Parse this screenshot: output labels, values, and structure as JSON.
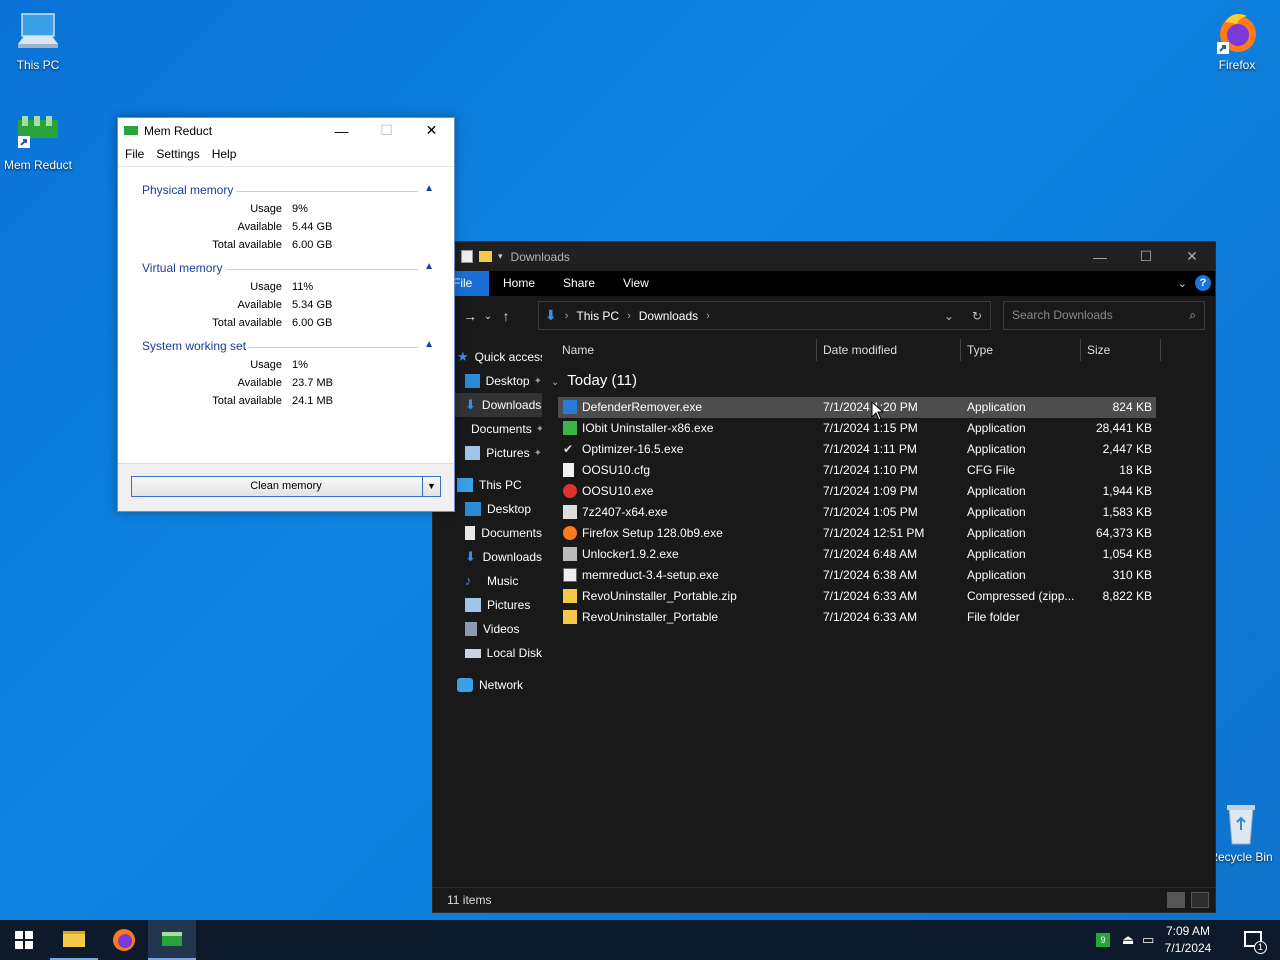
{
  "desktop": {
    "icons": {
      "this_pc": "This PC",
      "mem_reduct": "Mem Reduct",
      "firefox": "Firefox",
      "recycle_bin": "Recycle Bin"
    }
  },
  "memreduct": {
    "title": "Mem Reduct",
    "menu": [
      "File",
      "Settings",
      "Help"
    ],
    "groups": [
      {
        "title": "Physical memory",
        "rows": [
          {
            "label": "Usage",
            "value": "9%"
          },
          {
            "label": "Available",
            "value": "5.44 GB"
          },
          {
            "label": "Total available",
            "value": "6.00 GB"
          }
        ]
      },
      {
        "title": "Virtual memory",
        "rows": [
          {
            "label": "Usage",
            "value": "11%"
          },
          {
            "label": "Available",
            "value": "5.34 GB"
          },
          {
            "label": "Total available",
            "value": "6.00 GB"
          }
        ]
      },
      {
        "title": "System working set",
        "rows": [
          {
            "label": "Usage",
            "value": "1%"
          },
          {
            "label": "Available",
            "value": "23.7 MB"
          },
          {
            "label": "Total available",
            "value": "24.1 MB"
          }
        ]
      }
    ],
    "clean_button": "Clean memory"
  },
  "explorer": {
    "title": "Downloads",
    "ribbon_tabs": [
      "File",
      "Home",
      "Share",
      "View"
    ],
    "breadcrumb": [
      "This PC",
      "Downloads"
    ],
    "search_placeholder": "Search Downloads",
    "nav": {
      "quick_access": "Quick access",
      "pinned": [
        "Desktop",
        "Downloads",
        "Documents",
        "Pictures"
      ],
      "this_pc": "This PC",
      "this_pc_items": [
        "Desktop",
        "Documents",
        "Downloads",
        "Music",
        "Pictures",
        "Videos",
        "Local Disk"
      ],
      "network": "Network"
    },
    "columns": [
      "Name",
      "Date modified",
      "Type",
      "Size"
    ],
    "group_header": "Today (11)",
    "files": [
      {
        "name": "DefenderRemover.exe",
        "date": "7/1/2024 1:20 PM",
        "type": "Application",
        "size": "824 KB",
        "icon": "shield-app-icon"
      },
      {
        "name": "IObit Uninstaller-x86.exe",
        "date": "7/1/2024 1:15 PM",
        "type": "Application",
        "size": "28,441 KB",
        "icon": "iobit-icon"
      },
      {
        "name": "Optimizer-16.5.exe",
        "date": "7/1/2024 1:11 PM",
        "type": "Application",
        "size": "2,447 KB",
        "icon": "checkmark-icon"
      },
      {
        "name": "OOSU10.cfg",
        "date": "7/1/2024 1:10 PM",
        "type": "CFG File",
        "size": "18 KB",
        "icon": "blank-file-icon"
      },
      {
        "name": "OOSU10.exe",
        "date": "7/1/2024 1:09 PM",
        "type": "Application",
        "size": "1,944 KB",
        "icon": "oosu-icon"
      },
      {
        "name": "7z2407-x64.exe",
        "date": "7/1/2024 1:05 PM",
        "type": "Application",
        "size": "1,583 KB",
        "icon": "7zip-icon"
      },
      {
        "name": "Firefox Setup 128.0b9.exe",
        "date": "7/1/2024 12:51 PM",
        "type": "Application",
        "size": "64,373 KB",
        "icon": "firefox-setup-icon"
      },
      {
        "name": "Unlocker1.9.2.exe",
        "date": "7/1/2024 6:48 AM",
        "type": "Application",
        "size": "1,054 KB",
        "icon": "unlocker-icon"
      },
      {
        "name": "memreduct-3.4-setup.exe",
        "date": "7/1/2024 6:38 AM",
        "type": "Application",
        "size": "310 KB",
        "icon": "installer-icon"
      },
      {
        "name": "RevoUninstaller_Portable.zip",
        "date": "7/1/2024 6:33 AM",
        "type": "Compressed (zipp...",
        "size": "8,822 KB",
        "icon": "zip-folder-icon"
      },
      {
        "name": "RevoUninstaller_Portable",
        "date": "7/1/2024 6:33 AM",
        "type": "File folder",
        "size": "",
        "icon": "folder-icon"
      }
    ],
    "status": "11 items"
  },
  "taskbar": {
    "time": "7:09 AM",
    "date": "7/1/2024",
    "tray_badge": "9",
    "notification_count": "1"
  },
  "colors": {
    "desktop": "#0e7fdd",
    "explorer_bg": "#191919",
    "accent": "#1a6fd6",
    "memreduct_group": "#1a3d9e"
  }
}
